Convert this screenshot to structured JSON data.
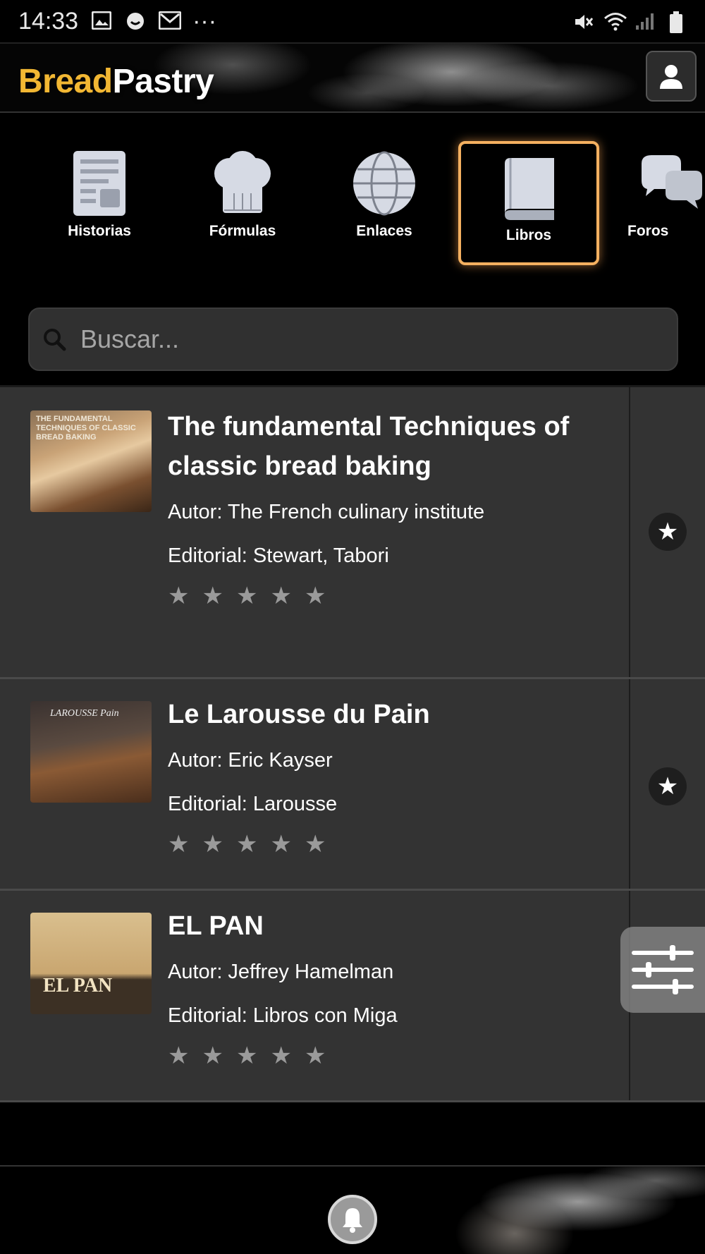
{
  "status_bar": {
    "time": "14:33",
    "dots": "···"
  },
  "header": {
    "logo_part1": "Bread",
    "logo_part2": "Pastry"
  },
  "categories": [
    {
      "label": "Historias",
      "icon": "news-icon",
      "active": false
    },
    {
      "label": "Fórmulas",
      "icon": "chef-hat-icon",
      "active": false
    },
    {
      "label": "Enlaces",
      "icon": "globe-icon",
      "active": false
    },
    {
      "label": "Libros",
      "icon": "book-icon",
      "active": true
    },
    {
      "label": "Foros",
      "icon": "chat-bubbles-icon",
      "active": false
    }
  ],
  "search": {
    "placeholder": "Buscar..."
  },
  "books": [
    {
      "title": "The fundamental Techniques of classic bread baking",
      "author": "Autor: The French culinary institute",
      "publisher": "Editorial: Stewart, Tabori",
      "rating": 0,
      "cover_text": "THE FUNDAMENTAL TECHNIQUES OF CLASSIC BREAD BAKING"
    },
    {
      "title": "Le Larousse du Pain",
      "author": "Autor: Eric Kayser",
      "publisher": "Editorial: Larousse",
      "rating": 0,
      "cover_text": "LAROUSSE Pain"
    },
    {
      "title": "EL PAN",
      "author": "Autor: Jeffrey Hamelman",
      "publisher": "Editorial: Libros con Miga",
      "rating": 0,
      "cover_text": "EL PAN"
    }
  ],
  "colors": {
    "brand_yellow": "#f2b733",
    "active_border": "#f4b060",
    "list_bg": "#333333"
  }
}
